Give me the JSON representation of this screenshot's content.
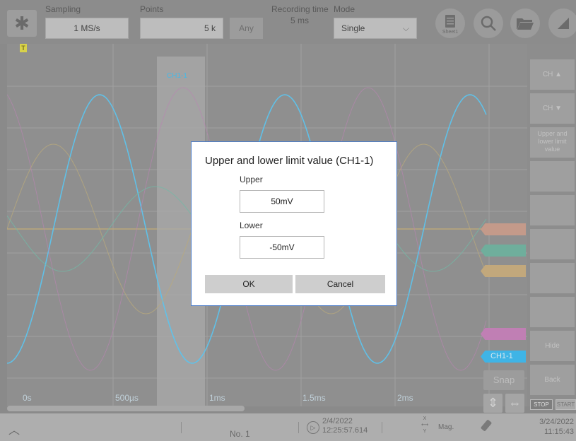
{
  "toolbar": {
    "settings_icon": "gear-icon",
    "sampling_label": "Sampling",
    "sampling_value": "1 MS/s",
    "points_label": "Points",
    "points_value": "5 k",
    "any_label": "Any",
    "recording_time_label": "Recording time",
    "recording_time_value": "5 ms",
    "mode_label": "Mode",
    "mode_value": "Single",
    "sheet_label": "Sheet1",
    "icons": [
      "sheet-icon",
      "search-icon",
      "folder-open-icon",
      "expand-icon"
    ]
  },
  "plot": {
    "cursor_marker": "T",
    "x_ticks": [
      "0s",
      "500µs",
      "1ms",
      "1.5ms",
      "2ms"
    ],
    "band_label": "CH1-1",
    "channel_tags": [
      {
        "label": "",
        "color": "#c49a8a"
      },
      {
        "label": "",
        "color": "#6fae9c"
      },
      {
        "label": "",
        "color": "#c2a87c"
      },
      {
        "label": "",
        "color": "#c07fb4"
      },
      {
        "label": "CH1-1",
        "color": "#3fb4e6"
      }
    ]
  },
  "side_panel": {
    "ch_up": "CH ▲",
    "ch_down": "CH ▼",
    "limit_value": "Upper and lower limit value",
    "hide": "Hide",
    "back": "Back",
    "stop": "STOP",
    "start": "START"
  },
  "snap": "Snap",
  "bottom_bar": {
    "record_no": "No. 1",
    "trigger_date": "2/4/2022",
    "trigger_time": "12:25:57.614",
    "mag_label": "Mag.",
    "axis_x": "X",
    "axis_y": "Y",
    "clock_date": "3/24/2022",
    "clock_time": "11:15:43"
  },
  "dialog": {
    "title": "Upper and lower limit value (CH1-1)",
    "upper_label": "Upper",
    "upper_value": "50mV",
    "lower_label": "Lower",
    "lower_value": "-50mV",
    "ok": "OK",
    "cancel": "Cancel"
  }
}
